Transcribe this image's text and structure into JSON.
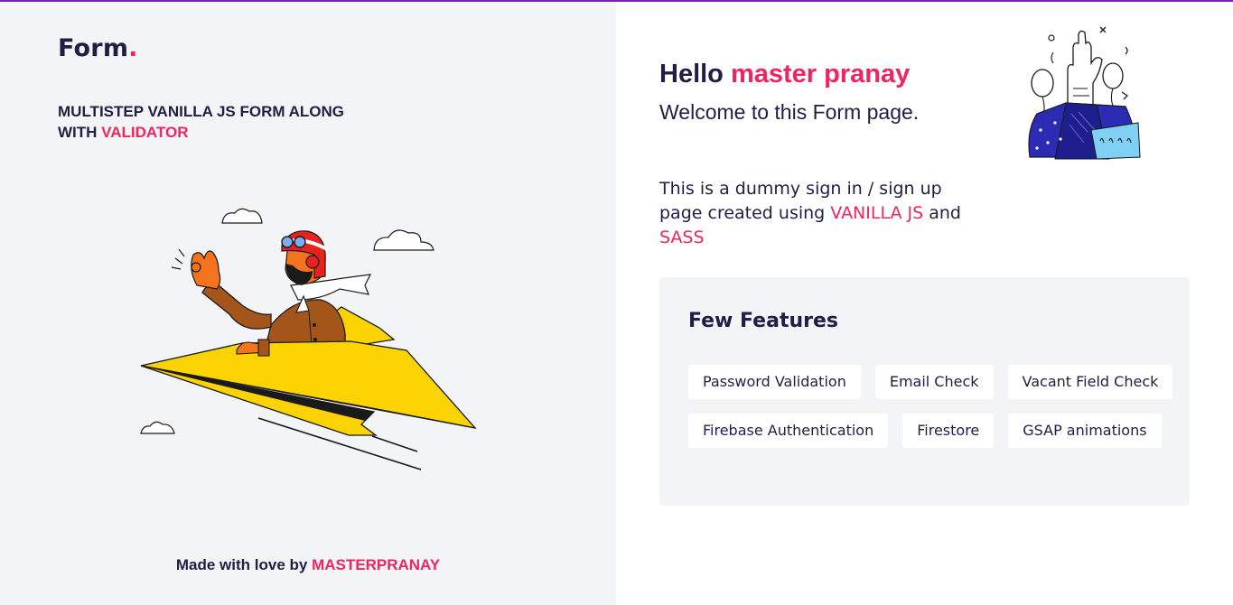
{
  "brand": {
    "name": "Form",
    "dot": "."
  },
  "left": {
    "subtitle_main": "MULTISTEP VANILLA JS FORM ALONG WITH",
    "subtitle_accent": "VALIDATOR",
    "footer_prefix": "Made with love by",
    "footer_author": "MASTERPRANAY",
    "illustration_icon": "paper-plane-pilot-illustration"
  },
  "right": {
    "hello_prefix": "Hello",
    "hello_name": "master pranay",
    "welcome": "Welcome to this Form page.",
    "desc_prefix": "This is a dummy sign in / sign up page created using",
    "desc_tech1": "VANILLA JS",
    "desc_and": "and",
    "desc_tech2": "SASS",
    "illustration_icon": "raised-hand-balloons-illustration",
    "features_title": "Few Features",
    "features": [
      "Password Validation",
      "Email Check",
      "Vacant Field Check",
      "Firebase Authentication",
      "Firestore",
      "GSAP animations"
    ]
  },
  "colors": {
    "accent": "#f0245f",
    "text": "#1f1f45",
    "top_bar": "#7a1fb5",
    "left_bg": "#f3f4f6",
    "plane_yellow": "#fcd302"
  }
}
